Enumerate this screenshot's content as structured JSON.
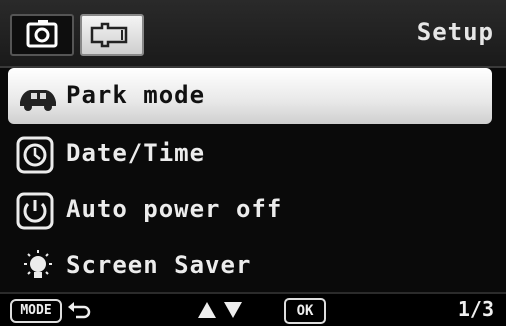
{
  "header": {
    "title": "Setup",
    "tabs": [
      {
        "name": "camera",
        "icon": "camera-icon",
        "active": false
      },
      {
        "name": "setup",
        "icon": "wrench-icon",
        "active": true
      }
    ]
  },
  "menu": {
    "items": [
      {
        "label": "Park mode",
        "icon": "car-icon",
        "selected": true
      },
      {
        "label": "Date/Time",
        "icon": "clock-icon",
        "selected": false
      },
      {
        "label": "Auto power off",
        "icon": "power-icon",
        "selected": false
      },
      {
        "label": "Screen Saver",
        "icon": "light-bulb-icon",
        "selected": false
      }
    ]
  },
  "footer": {
    "mode_label": "MODE",
    "ok_label": "OK",
    "page": "1/3"
  }
}
